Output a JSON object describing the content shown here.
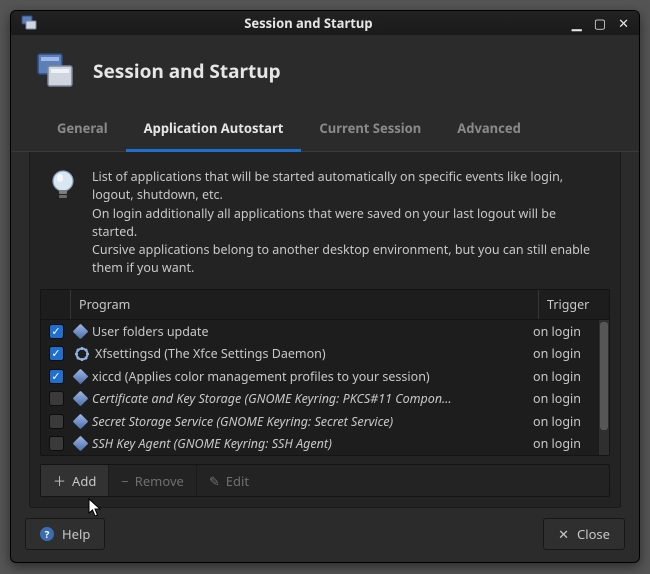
{
  "window": {
    "title": "Session and Startup"
  },
  "header": {
    "title": "Session and Startup"
  },
  "tabs": [
    {
      "id": "general",
      "label": "General"
    },
    {
      "id": "autostart",
      "label": "Application Autostart"
    },
    {
      "id": "session",
      "label": "Current Session"
    },
    {
      "id": "advanced",
      "label": "Advanced"
    }
  ],
  "active_tab": "autostart",
  "info_lines": [
    "List of applications that will be started automatically on specific events like login, logout, shutdown, etc.",
    "On login additionally all applications that were saved on your last logout will be started.",
    "Cursive applications belong to another desktop environment, but you can still enable them if you want."
  ],
  "columns": {
    "program": "Program",
    "trigger": "Trigger"
  },
  "rows": [
    {
      "checked": true,
      "icon": "diamond",
      "name": "User folders update",
      "cursive": false,
      "trigger": "on login"
    },
    {
      "checked": true,
      "icon": "gear",
      "name": "Xfsettingsd (The Xfce Settings Daemon)",
      "cursive": false,
      "trigger": "on login"
    },
    {
      "checked": true,
      "icon": "diamond",
      "name": "xiccd (Applies color management profiles to your session)",
      "cursive": false,
      "trigger": "on login"
    },
    {
      "checked": false,
      "icon": "diamond",
      "name": "Certificate and Key Storage (GNOME Keyring: PKCS#11 Compon…",
      "cursive": true,
      "trigger": "on login"
    },
    {
      "checked": false,
      "icon": "diamond",
      "name": "Secret Storage Service (GNOME Keyring: Secret Service)",
      "cursive": true,
      "trigger": "on login"
    },
    {
      "checked": false,
      "icon": "diamond",
      "name": "SSH Key Agent (GNOME Keyring: SSH Agent)",
      "cursive": true,
      "trigger": "on login"
    }
  ],
  "toolbar": {
    "add": {
      "label": "Add",
      "enabled": true
    },
    "remove": {
      "label": "Remove",
      "enabled": false
    },
    "edit": {
      "label": "Edit",
      "enabled": false
    }
  },
  "footer": {
    "help": "Help",
    "close": "Close"
  }
}
